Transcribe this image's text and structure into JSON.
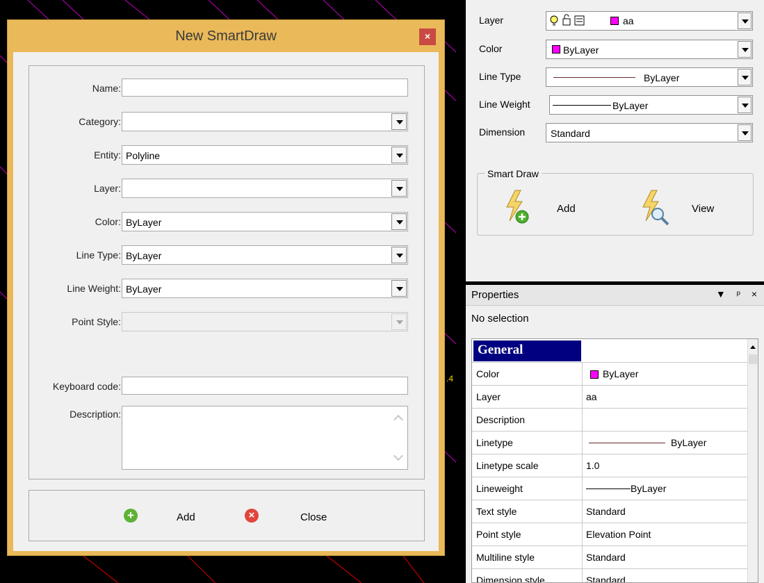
{
  "dialog": {
    "title": "New SmartDraw",
    "close_glyph": "×",
    "fields": [
      {
        "label": "Name:",
        "value": "",
        "type": "text"
      },
      {
        "label": "Category:",
        "value": "",
        "type": "dropdown"
      },
      {
        "label": "Entity:",
        "value": "Polyline",
        "type": "dropdown"
      },
      {
        "label": "Layer:",
        "value": "",
        "type": "dropdown"
      },
      {
        "label": "Color:",
        "value": "ByLayer",
        "type": "dropdown"
      },
      {
        "label": "Line Type:",
        "value": "ByLayer",
        "type": "dropdown"
      },
      {
        "label": "Line Weight:",
        "value": "ByLayer",
        "type": "dropdown"
      },
      {
        "label": "Point Style:",
        "value": "",
        "type": "dropdown-disabled"
      }
    ],
    "keyboard_code": {
      "label": "Keyboard code:",
      "value": ""
    },
    "description": {
      "label": "Description:",
      "value": ""
    },
    "buttons": {
      "add": "Add",
      "close": "Close"
    }
  },
  "layer_panel": {
    "rows": [
      {
        "label": "Layer",
        "value": "aa"
      },
      {
        "label": "Color",
        "value": "ByLayer"
      },
      {
        "label": "Line Type",
        "value": "ByLayer"
      },
      {
        "label": "Line Weight",
        "value": "ByLayer"
      },
      {
        "label": "Dimension",
        "value": "Standard"
      }
    ],
    "smart_draw": {
      "legend": "Smart Draw",
      "add": "Add",
      "view": "View"
    }
  },
  "properties": {
    "title": "Properties",
    "controls": "▼ ᵖ ×",
    "selection": "No selection",
    "group": "General",
    "rows": [
      {
        "name": "Color",
        "value": "ByLayer"
      },
      {
        "name": "Layer",
        "value": "aa"
      },
      {
        "name": "Description",
        "value": ""
      },
      {
        "name": "Linetype",
        "value": "ByLayer"
      },
      {
        "name": "Linetype scale",
        "value": "1.0"
      },
      {
        "name": "Lineweight",
        "value": "ByLayer"
      },
      {
        "name": "Text style",
        "value": "Standard"
      },
      {
        "name": "Point style",
        "value": "Elevation Point"
      },
      {
        "name": "Multiline style",
        "value": "Standard"
      },
      {
        "name": "Dimension style",
        "value": "Standard"
      }
    ]
  },
  "colors": {
    "layer_swatch": "#FF00FF",
    "dialog_frame": "#EAB959",
    "group_header": "#000080"
  }
}
